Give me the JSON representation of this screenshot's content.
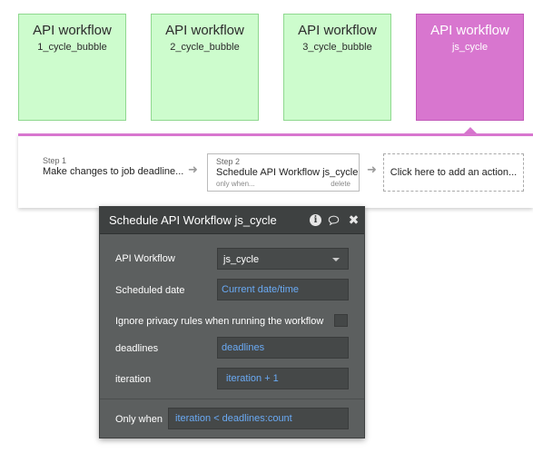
{
  "workflows": [
    {
      "title": "API workflow",
      "name": "1_cycle_bubble",
      "active": false
    },
    {
      "title": "API workflow",
      "name": "2_cycle_bubble",
      "active": false
    },
    {
      "title": "API workflow",
      "name": "3_cycle_bubble",
      "active": false
    },
    {
      "title": "API workflow",
      "name": "js_cycle",
      "active": true
    }
  ],
  "colors": {
    "card_bg": "#cdfccd",
    "card_active_bg": "#d876cf",
    "panel_bg": "#5c5f5f",
    "dynamic_text": "#6aaaf4"
  },
  "steps": {
    "step1": {
      "num": "Step 1",
      "text": "Make changes to job deadline..."
    },
    "step2": {
      "num": "Step 2",
      "text": "Schedule API Workflow js_cycle",
      "sub": "only when...",
      "delete": "delete"
    },
    "add_action": "Click here to add an action..."
  },
  "panel": {
    "title": "Schedule API Workflow js_cycle",
    "icons": [
      "info-icon",
      "comment-icon",
      "close-icon"
    ],
    "api_workflow": {
      "label": "API Workflow",
      "value": "js_cycle"
    },
    "scheduled_date": {
      "label": "Scheduled date",
      "value": "Current date/time"
    },
    "ignore_privacy": {
      "label": "Ignore privacy rules when running the workflow",
      "checked": false
    },
    "deadlines": {
      "label": "deadlines",
      "value": "deadlines"
    },
    "iteration": {
      "label": "iteration",
      "value": "iteration + 1"
    },
    "only_when": {
      "label": "Only when",
      "value": "iteration < deadlines:count"
    }
  }
}
